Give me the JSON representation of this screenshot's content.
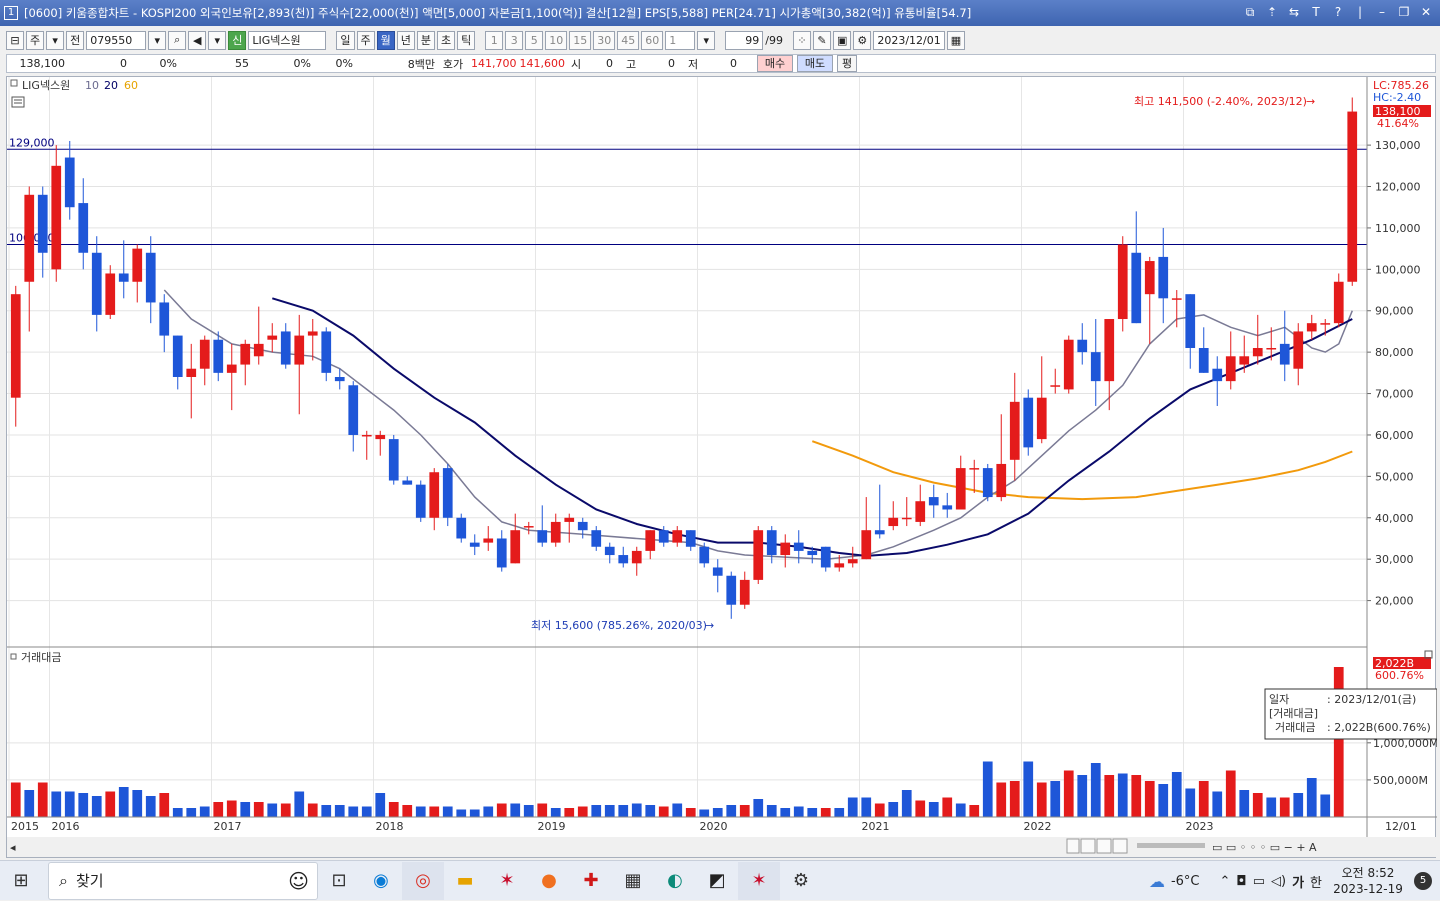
{
  "window": {
    "title": "[0600] 키움종합차트 - KOSPI200 외국인보유[2,893(천)] 주식수[22,000(천)] 액면[5,000] 자본금[1,100(억)] 결산[12월] EPS[5,588] PER[24.71] 시가총액[30,382(억)] 유통비율[54.7]",
    "number_badge": "1",
    "controls": [
      "⧉",
      "⇡",
      "⇆",
      "T",
      "?",
      "|",
      "–",
      "❐",
      "✕"
    ]
  },
  "toolbar": {
    "type_label": "주",
    "all_label": "전",
    "code": "079550",
    "stock_badge": "신",
    "stock_name": "LIG넥스원",
    "periods": [
      {
        "label": "일",
        "selected": false
      },
      {
        "label": "주",
        "selected": false
      },
      {
        "label": "월",
        "selected": true
      },
      {
        "label": "년",
        "selected": false
      },
      {
        "label": "분",
        "selected": false
      },
      {
        "label": "초",
        "selected": false
      },
      {
        "label": "틱",
        "selected": false
      }
    ],
    "intervals": [
      "1",
      "3",
      "5",
      "10",
      "15",
      "30",
      "45",
      "60"
    ],
    "interval_value": "1",
    "count": "99",
    "count_total": "/99",
    "date": "2023/12/01"
  },
  "quote": {
    "price": "138,100",
    "change": "0",
    "change_pct": "0%",
    "volume": "55",
    "vol_pct": "0%",
    "other_pct": "0%",
    "amount": "8백만",
    "ask_label": "호가",
    "ask": "141,700",
    "bid": "141,600",
    "open_label": "시",
    "open": "0",
    "high_label": "고",
    "high": "0",
    "low_label": "저",
    "low": "0",
    "buy_label": "매수",
    "sell_label": "매도",
    "avg_label": "평"
  },
  "legend": {
    "name": "LIG넥스원",
    "ma1": "10",
    "ma2": "20",
    "ma3": "60",
    "ma1_color": "#6b6b8f",
    "ma2_color": "#000066",
    "ma3_color": "#ff9900"
  },
  "volume_panel": {
    "title": "거래대금"
  },
  "colors": {
    "up": "#e41b1b",
    "down": "#1e56d8",
    "level_line": "#000080",
    "ma10": "#7a7a95",
    "ma20": "#0a0a6a",
    "ma60": "#f29a0c"
  },
  "chart_data": {
    "type": "candlestick",
    "title": "",
    "xlabel": "",
    "ylabel": "",
    "ylim": [
      10000,
      145000
    ],
    "y_ticks": [
      20000,
      30000,
      40000,
      50000,
      60000,
      70000,
      80000,
      90000,
      100000,
      110000,
      120000,
      130000
    ],
    "y_tick_labels": [
      "20,000",
      "30,000",
      "40,000",
      "50,000",
      "60,000",
      "70,000",
      "80,000",
      "90,000",
      "100,000",
      "110,000",
      "120,000",
      "130,000"
    ],
    "x_labels": [
      {
        "index": 0,
        "label": "2015"
      },
      {
        "index": 3,
        "label": "2016"
      },
      {
        "index": 15,
        "label": "2017"
      },
      {
        "index": 27,
        "label": "2018"
      },
      {
        "index": 39,
        "label": "2019"
      },
      {
        "index": 51,
        "label": "2020"
      },
      {
        "index": 63,
        "label": "2021"
      },
      {
        "index": 75,
        "label": "2022"
      },
      {
        "index": 87,
        "label": "2023"
      }
    ],
    "x_end_label": "12/01",
    "horizontal_lines": [
      {
        "value": 129000,
        "label": "129,000"
      },
      {
        "value": 106000,
        "label": "106,000"
      }
    ],
    "header_labels": {
      "lc": "LC:785.26",
      "hc": "HC:-2.40"
    },
    "last_price_label": "138,100",
    "last_pct_label": "41.64%",
    "annotations": {
      "high": "최고 141,500 (-2.40%, 2023/12)",
      "low": "최저 15,600 (785.26%, 2020/03)"
    },
    "candles": [
      {
        "o": 69000,
        "c": 94000,
        "h": 96000,
        "l": 62000
      },
      {
        "o": 97000,
        "c": 118000,
        "h": 120000,
        "l": 85000
      },
      {
        "o": 118000,
        "c": 104000,
        "h": 120000,
        "l": 98000
      },
      {
        "o": 100000,
        "c": 125000,
        "h": 130000,
        "l": 97000
      },
      {
        "o": 127000,
        "c": 115000,
        "h": 131000,
        "l": 112000
      },
      {
        "o": 116000,
        "c": 104000,
        "h": 122000,
        "l": 100000
      },
      {
        "o": 104000,
        "c": 89000,
        "h": 108000,
        "l": 85000
      },
      {
        "o": 89000,
        "c": 99000,
        "h": 101000,
        "l": 88000
      },
      {
        "o": 99000,
        "c": 97000,
        "h": 107000,
        "l": 93000
      },
      {
        "o": 97000,
        "c": 105000,
        "h": 106000,
        "l": 92000
      },
      {
        "o": 104000,
        "c": 92000,
        "h": 108000,
        "l": 87000
      },
      {
        "o": 92000,
        "c": 84000,
        "h": 94000,
        "l": 80000
      },
      {
        "o": 84000,
        "c": 74000,
        "h": 84000,
        "l": 71000
      },
      {
        "o": 74000,
        "c": 76000,
        "h": 82000,
        "l": 64000
      },
      {
        "o": 76000,
        "c": 83000,
        "h": 84000,
        "l": 72000
      },
      {
        "o": 83000,
        "c": 75000,
        "h": 85000,
        "l": 73000
      },
      {
        "o": 75000,
        "c": 77000,
        "h": 82000,
        "l": 66000
      },
      {
        "o": 77000,
        "c": 82000,
        "h": 83000,
        "l": 72000
      },
      {
        "o": 79000,
        "c": 82000,
        "h": 91000,
        "l": 77000
      },
      {
        "o": 83000,
        "c": 84000,
        "h": 87000,
        "l": 80000
      },
      {
        "o": 85000,
        "c": 77000,
        "h": 87000,
        "l": 76000
      },
      {
        "o": 77000,
        "c": 84000,
        "h": 89000,
        "l": 65000
      },
      {
        "o": 84000,
        "c": 85000,
        "h": 88000,
        "l": 78000
      },
      {
        "o": 85000,
        "c": 75000,
        "h": 86000,
        "l": 73000
      },
      {
        "o": 74000,
        "c": 73000,
        "h": 76000,
        "l": 71000
      },
      {
        "o": 72000,
        "c": 60000,
        "h": 73000,
        "l": 56000
      },
      {
        "o": 60000,
        "c": 60000,
        "h": 61000,
        "l": 54000
      },
      {
        "o": 59000,
        "c": 60000,
        "h": 61000,
        "l": 55000
      },
      {
        "o": 59000,
        "c": 49000,
        "h": 60000,
        "l": 48000
      },
      {
        "o": 49000,
        "c": 48000,
        "h": 50000,
        "l": 48000
      },
      {
        "o": 48000,
        "c": 40000,
        "h": 49000,
        "l": 39000
      },
      {
        "o": 40000,
        "c": 51000,
        "h": 52000,
        "l": 37000
      },
      {
        "o": 52000,
        "c": 40000,
        "h": 53000,
        "l": 38000
      },
      {
        "o": 40000,
        "c": 35000,
        "h": 41000,
        "l": 34000
      },
      {
        "o": 34000,
        "c": 33000,
        "h": 36000,
        "l": 31000
      },
      {
        "o": 34000,
        "c": 35000,
        "h": 38000,
        "l": 32000
      },
      {
        "o": 35000,
        "c": 28000,
        "h": 37000,
        "l": 27000
      },
      {
        "o": 29000,
        "c": 37000,
        "h": 41000,
        "l": 29000
      },
      {
        "o": 38000,
        "c": 38000,
        "h": 39000,
        "l": 36000
      },
      {
        "o": 37000,
        "c": 34000,
        "h": 43000,
        "l": 33000
      },
      {
        "o": 34000,
        "c": 39000,
        "h": 41000,
        "l": 33000
      },
      {
        "o": 39000,
        "c": 40000,
        "h": 41000,
        "l": 34000
      },
      {
        "o": 39000,
        "c": 37000,
        "h": 40000,
        "l": 35000
      },
      {
        "o": 37000,
        "c": 33000,
        "h": 38000,
        "l": 32000
      },
      {
        "o": 33000,
        "c": 31000,
        "h": 34000,
        "l": 29000
      },
      {
        "o": 31000,
        "c": 29000,
        "h": 33000,
        "l": 28000
      },
      {
        "o": 29000,
        "c": 32000,
        "h": 33000,
        "l": 26000
      },
      {
        "o": 32000,
        "c": 37000,
        "h": 37000,
        "l": 30000
      },
      {
        "o": 37000,
        "c": 34000,
        "h": 38000,
        "l": 33000
      },
      {
        "o": 34000,
        "c": 37000,
        "h": 38000,
        "l": 33000
      },
      {
        "o": 37000,
        "c": 33000,
        "h": 37000,
        "l": 32000
      },
      {
        "o": 33000,
        "c": 29000,
        "h": 34000,
        "l": 28000
      },
      {
        "o": 28000,
        "c": 26000,
        "h": 30000,
        "l": 22000
      },
      {
        "o": 26000,
        "c": 19000,
        "h": 27000,
        "l": 15600
      },
      {
        "o": 19000,
        "c": 25000,
        "h": 27000,
        "l": 18000
      },
      {
        "o": 25000,
        "c": 37000,
        "h": 38000,
        "l": 24000
      },
      {
        "o": 37000,
        "c": 31000,
        "h": 38000,
        "l": 29000
      },
      {
        "o": 31000,
        "c": 34000,
        "h": 36000,
        "l": 28000
      },
      {
        "o": 34000,
        "c": 32000,
        "h": 37000,
        "l": 29000
      },
      {
        "o": 32000,
        "c": 31000,
        "h": 33000,
        "l": 29000
      },
      {
        "o": 33000,
        "c": 28000,
        "h": 33000,
        "l": 27000
      },
      {
        "o": 28000,
        "c": 29000,
        "h": 31000,
        "l": 27000
      },
      {
        "o": 29000,
        "c": 30000,
        "h": 33000,
        "l": 28000
      },
      {
        "o": 30000,
        "c": 37000,
        "h": 45000,
        "l": 30000
      },
      {
        "o": 37000,
        "c": 36000,
        "h": 48000,
        "l": 35000
      },
      {
        "o": 38000,
        "c": 40000,
        "h": 44000,
        "l": 37000
      },
      {
        "o": 40000,
        "c": 40000,
        "h": 45000,
        "l": 38000
      },
      {
        "o": 39000,
        "c": 44000,
        "h": 48000,
        "l": 38000
      },
      {
        "o": 45000,
        "c": 43000,
        "h": 48000,
        "l": 40000
      },
      {
        "o": 43000,
        "c": 42000,
        "h": 46000,
        "l": 40000
      },
      {
        "o": 42000,
        "c": 52000,
        "h": 55000,
        "l": 42000
      },
      {
        "o": 52000,
        "c": 52000,
        "h": 54000,
        "l": 46000
      },
      {
        "o": 52000,
        "c": 45000,
        "h": 53000,
        "l": 44000
      },
      {
        "o": 45000,
        "c": 53000,
        "h": 65000,
        "l": 44000
      },
      {
        "o": 54000,
        "c": 68000,
        "h": 75000,
        "l": 49000
      },
      {
        "o": 69000,
        "c": 57000,
        "h": 71000,
        "l": 55000
      },
      {
        "o": 59000,
        "c": 69000,
        "h": 79000,
        "l": 58000
      },
      {
        "o": 72000,
        "c": 72000,
        "h": 76000,
        "l": 70000
      },
      {
        "o": 71000,
        "c": 83000,
        "h": 84000,
        "l": 70000
      },
      {
        "o": 83000,
        "c": 80000,
        "h": 87000,
        "l": 77000
      },
      {
        "o": 80000,
        "c": 73000,
        "h": 88000,
        "l": 67000
      },
      {
        "o": 73000,
        "c": 88000,
        "h": 88000,
        "l": 66000
      },
      {
        "o": 88000,
        "c": 106000,
        "h": 108000,
        "l": 85000
      },
      {
        "o": 104000,
        "c": 87000,
        "h": 114000,
        "l": 87000
      },
      {
        "o": 94000,
        "c": 102000,
        "h": 103000,
        "l": 82000
      },
      {
        "o": 103000,
        "c": 93000,
        "h": 110000,
        "l": 87000
      },
      {
        "o": 93000,
        "c": 93000,
        "h": 95000,
        "l": 86000
      },
      {
        "o": 94000,
        "c": 81000,
        "h": 94000,
        "l": 76000
      },
      {
        "o": 81000,
        "c": 75000,
        "h": 86000,
        "l": 75000
      },
      {
        "o": 76000,
        "c": 73000,
        "h": 79000,
        "l": 67000
      },
      {
        "o": 73000,
        "c": 79000,
        "h": 85000,
        "l": 71000
      },
      {
        "o": 77000,
        "c": 79000,
        "h": 84000,
        "l": 75000
      },
      {
        "o": 79000,
        "c": 81000,
        "h": 89000,
        "l": 77000
      },
      {
        "o": 81000,
        "c": 81000,
        "h": 86000,
        "l": 78000
      },
      {
        "o": 82000,
        "c": 77000,
        "h": 90000,
        "l": 73000
      },
      {
        "o": 76000,
        "c": 85000,
        "h": 87000,
        "l": 72000
      },
      {
        "o": 85000,
        "c": 87000,
        "h": 89000,
        "l": 83000
      },
      {
        "o": 87000,
        "c": 87000,
        "h": 88000,
        "l": 84000
      },
      {
        "o": 87000,
        "c": 97000,
        "h": 99000,
        "l": 86000
      },
      {
        "o": 97000,
        "c": 138100,
        "h": 141500,
        "l": 96000
      }
    ],
    "ma10": [
      [
        11,
        95000
      ],
      [
        13,
        88000
      ],
      [
        16,
        82000
      ],
      [
        19,
        80000
      ],
      [
        22,
        79000
      ],
      [
        24,
        76000
      ],
      [
        26,
        71000
      ],
      [
        28,
        66000
      ],
      [
        30,
        60000
      ],
      [
        32,
        53000
      ],
      [
        34,
        45000
      ],
      [
        36,
        39000
      ],
      [
        38,
        37000
      ],
      [
        42,
        36000
      ],
      [
        46,
        35000
      ],
      [
        50,
        34000
      ],
      [
        52,
        32000
      ],
      [
        54,
        31000
      ],
      [
        57,
        30500
      ],
      [
        60,
        30000
      ],
      [
        63,
        31000
      ],
      [
        65,
        33000
      ],
      [
        68,
        37000
      ],
      [
        70,
        40000
      ],
      [
        72,
        45000
      ],
      [
        74,
        49000
      ],
      [
        76,
        55000
      ],
      [
        78,
        61000
      ],
      [
        80,
        66000
      ],
      [
        82,
        72000
      ],
      [
        84,
        82000
      ],
      [
        86,
        88000
      ],
      [
        88,
        89000
      ],
      [
        90,
        86000
      ],
      [
        92,
        84000
      ],
      [
        94,
        86000
      ],
      [
        96,
        81000
      ],
      [
        97,
        80000
      ],
      [
        98,
        82000
      ],
      [
        99,
        90000
      ]
    ],
    "ma20": [
      [
        19,
        93000
      ],
      [
        22,
        90000
      ],
      [
        25,
        84000
      ],
      [
        28,
        76000
      ],
      [
        31,
        69000
      ],
      [
        34,
        63000
      ],
      [
        37,
        55000
      ],
      [
        40,
        48000
      ],
      [
        43,
        42000
      ],
      [
        46,
        38500
      ],
      [
        49,
        36000
      ],
      [
        52,
        34000
      ],
      [
        55,
        34000
      ],
      [
        58,
        33000
      ],
      [
        61,
        31500
      ],
      [
        63,
        30800
      ],
      [
        66,
        31500
      ],
      [
        69,
        33500
      ],
      [
        72,
        36000
      ],
      [
        75,
        41000
      ],
      [
        78,
        49000
      ],
      [
        81,
        56000
      ],
      [
        84,
        64000
      ],
      [
        87,
        71000
      ],
      [
        90,
        75000
      ],
      [
        93,
        79000
      ],
      [
        96,
        83000
      ],
      [
        99,
        88000
      ]
    ],
    "ma60": [
      [
        59,
        58500
      ],
      [
        62,
        55000
      ],
      [
        65,
        51000
      ],
      [
        68,
        48500
      ],
      [
        72,
        46000
      ],
      [
        75,
        45000
      ],
      [
        79,
        44500
      ],
      [
        83,
        45000
      ],
      [
        86,
        46500
      ],
      [
        89,
        48000
      ],
      [
        92,
        49500
      ],
      [
        95,
        51500
      ],
      [
        97,
        53500
      ],
      [
        99,
        56000
      ]
    ],
    "volume": [
      23,
      18,
      23,
      17,
      17,
      16,
      14,
      17,
      20,
      18,
      14,
      16,
      6,
      6,
      7,
      10,
      11,
      10,
      10,
      9,
      9,
      17,
      9,
      8,
      8,
      7,
      7,
      16,
      10,
      8,
      7,
      7,
      7,
      5,
      5,
      7,
      9,
      9,
      8,
      9,
      6,
      6,
      7,
      8,
      8,
      8,
      9,
      8,
      7,
      9,
      6,
      5,
      6,
      8,
      8,
      12,
      8,
      6,
      7,
      6,
      6,
      6,
      13,
      13,
      9,
      10,
      18,
      11,
      10,
      13,
      9,
      8,
      37,
      23,
      24,
      37,
      23,
      24,
      31,
      28,
      36,
      28,
      29,
      28,
      24,
      22,
      30,
      19,
      24,
      17,
      31,
      18,
      16,
      13,
      13,
      16,
      26,
      15,
      100
    ],
    "volume_up": [
      true,
      false,
      true,
      false,
      false,
      false,
      false,
      true,
      false,
      false,
      false,
      true,
      false,
      false,
      false,
      true,
      true,
      false,
      true,
      false,
      true,
      false,
      true,
      false,
      false,
      false,
      false,
      false,
      true,
      true,
      false,
      true,
      false,
      false,
      false,
      false,
      true,
      false,
      false,
      true,
      false,
      true,
      true,
      false,
      false,
      false,
      false,
      false,
      true,
      false,
      true,
      false,
      false,
      false,
      true,
      false,
      false,
      false,
      false,
      false,
      true,
      false,
      false,
      false,
      true,
      false,
      false,
      true,
      false,
      true,
      false,
      true,
      false,
      true,
      true,
      false,
      true,
      false,
      true,
      false,
      false,
      true,
      false,
      true,
      true,
      false,
      false,
      false,
      true,
      false,
      true,
      false,
      true,
      false,
      true,
      false,
      false,
      false,
      true
    ],
    "volume_ticks": [
      {
        "value": 500,
        "label": "500,000M"
      },
      {
        "value": 1000,
        "label": "1,000,000M"
      }
    ],
    "volume_last_label": "2,022B",
    "volume_last_pct": "600.76%",
    "tooltip": {
      "date_label": "일자",
      "date_value": ": 2023/12/01(금)",
      "section": "[거래대금]",
      "value_label": "거래대금",
      "value": ": 2,022B(600.76%)"
    }
  },
  "taskbar": {
    "search_placeholder": "찾기",
    "weather": "-6°C",
    "ime": "가",
    "lang": "한",
    "time": "오전 8:52",
    "date": "2023-12-19",
    "notif_count": "5"
  }
}
